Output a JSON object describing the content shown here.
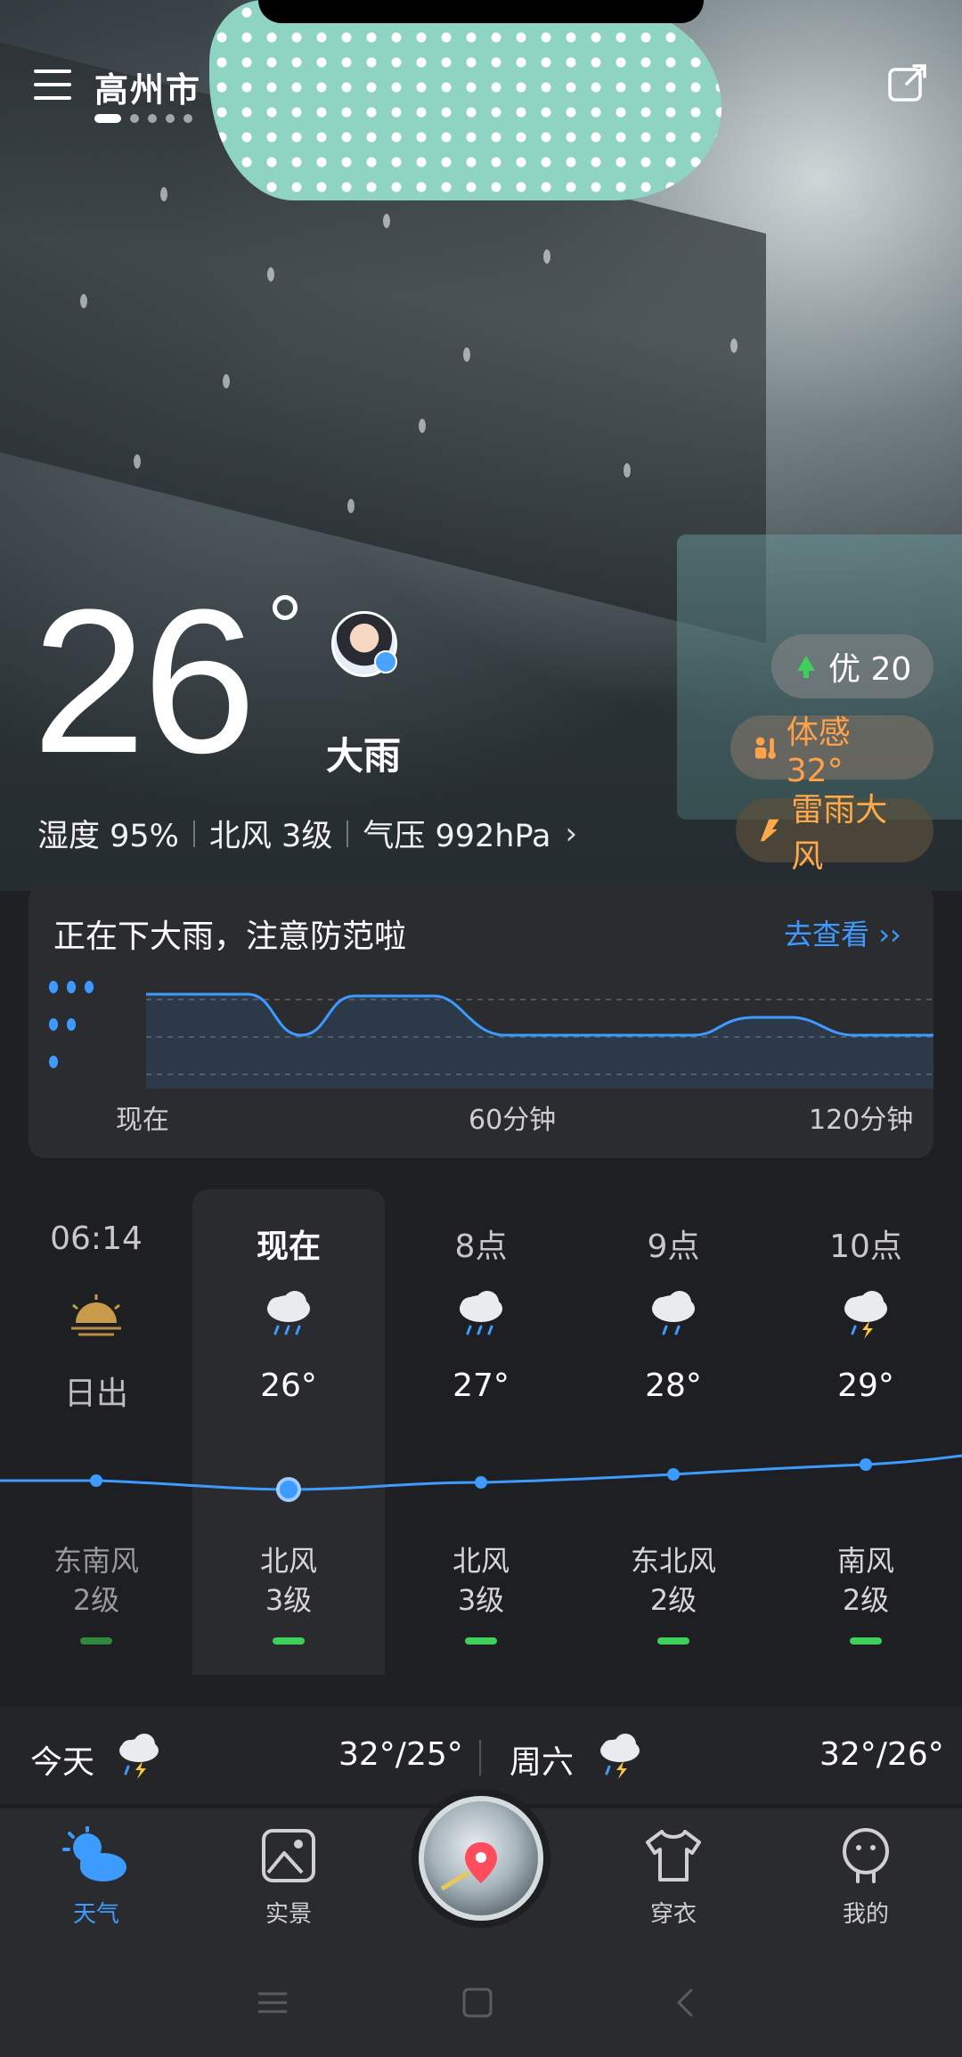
{
  "location": {
    "city": "高州市"
  },
  "current": {
    "temperature": "26",
    "condition": "大雨",
    "humidity": "湿度 95%",
    "wind": "北风 3级",
    "pressure": "气压 992hPa"
  },
  "badges": {
    "aqi": "优 20",
    "feels_like": "体感 32°",
    "warning": "雷雨大风"
  },
  "rain": {
    "title": "正在下大雨，注意防范啦",
    "link": "去查看",
    "labels": [
      "现在",
      "60分钟",
      "120分钟"
    ]
  },
  "hourly": [
    {
      "time": "06:14",
      "icon": "sunrise-icon",
      "temp": "日出",
      "wind_dir": "东南风",
      "wind_level": "2级"
    },
    {
      "time": "现在",
      "icon": "rain-icon",
      "temp": "26°",
      "wind_dir": "北风",
      "wind_level": "3级"
    },
    {
      "time": "8点",
      "icon": "rain-icon",
      "temp": "27°",
      "wind_dir": "北风",
      "wind_level": "3级"
    },
    {
      "time": "9点",
      "icon": "rain-icon",
      "temp": "28°",
      "wind_dir": "东北风",
      "wind_level": "2级"
    },
    {
      "time": "10点",
      "icon": "thunder-rain-icon",
      "temp": "29°",
      "wind_dir": "南风",
      "wind_level": "2级"
    }
  ],
  "daily": [
    {
      "day": "今天",
      "icon": "thunder-rain-icon",
      "range": "32°/25°"
    },
    {
      "day": "周六",
      "icon": "thunder-rain-icon",
      "range": "32°/26°"
    }
  ],
  "nav": {
    "weather": "天气",
    "live": "实景",
    "wear": "穿衣",
    "me": "我的"
  },
  "colors": {
    "accent": "#3d9bff",
    "wind_good": "#3fcf5b",
    "warn": "#ffa94a"
  }
}
